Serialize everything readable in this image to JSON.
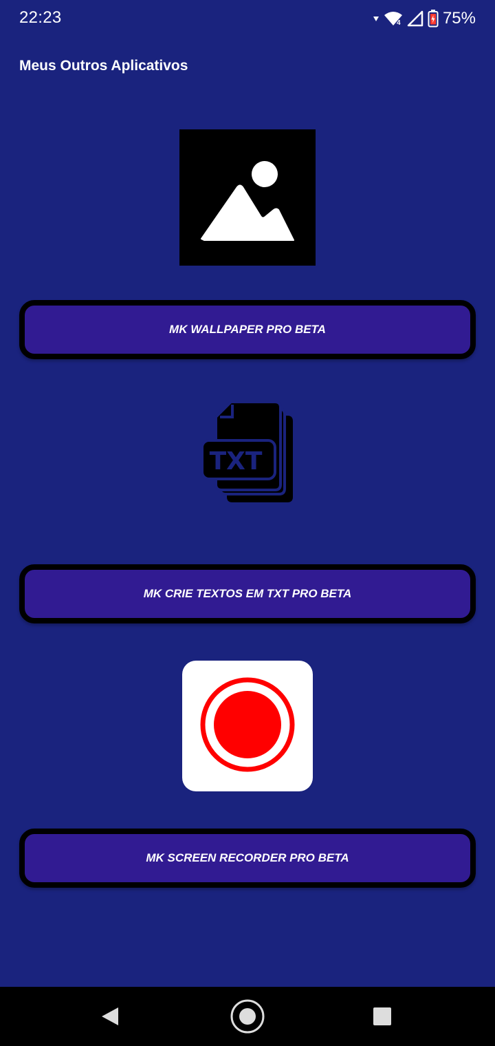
{
  "status_bar": {
    "time": "22:23",
    "battery": "75%"
  },
  "title": "Meus Outros Aplicativos",
  "apps": [
    {
      "name": "MK WALLPAPER PRO BETA",
      "icon": "image-placeholder-icon"
    },
    {
      "name": "MK CRIE TEXTOS EM TXT PRO BETA",
      "icon": "txt-file-icon"
    },
    {
      "name": "MK SCREEN RECORDER PRO BETA",
      "icon": "record-icon"
    }
  ],
  "colors": {
    "background": "#1a237e",
    "button": "#311b92",
    "button_border": "#000000",
    "record_red": "#ff0000"
  },
  "nav_bar": {
    "icons": [
      "back-icon",
      "home-icon",
      "recents-icon"
    ]
  }
}
